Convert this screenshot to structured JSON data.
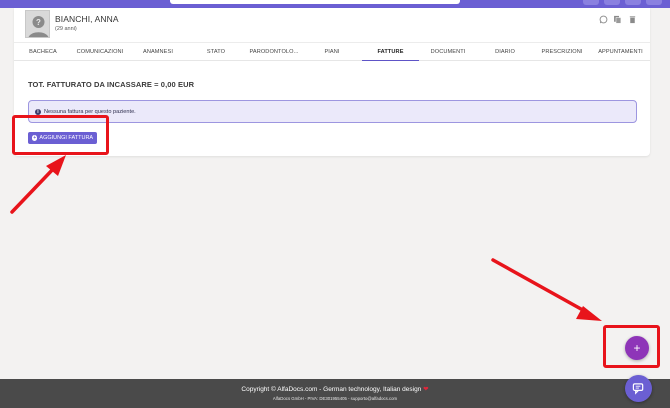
{
  "patient": {
    "name": "BIANCHI, ANNA",
    "age": "(29 anni)"
  },
  "header_icons": [
    "whatsapp-icon",
    "copy-icon",
    "trash-icon"
  ],
  "tabs": [
    {
      "label": "BACHECA",
      "active": false
    },
    {
      "label": "COMUNICAZIONI",
      "active": false
    },
    {
      "label": "ANAMNESI",
      "active": false
    },
    {
      "label": "STATO",
      "active": false
    },
    {
      "label": "PARODONTOLO...",
      "active": false
    },
    {
      "label": "PIANI",
      "active": false
    },
    {
      "label": "FATTURE",
      "active": true
    },
    {
      "label": "DOCUMENTI",
      "active": false
    },
    {
      "label": "DIARIO",
      "active": false
    },
    {
      "label": "PRESCRIZIONI",
      "active": false
    },
    {
      "label": "APPUNTAMENTI",
      "active": false
    }
  ],
  "invoices": {
    "total_label": "TOT. FATTURATO DA INCASSARE = 0,00 EUR",
    "empty_message": "Nessuna fattura per questo paziente.",
    "add_button_label": "AGGIUNGI FATTURA"
  },
  "fab": {
    "label": "+"
  },
  "footer": {
    "line1": "Copyright © AlfaDocs.com - German technology, Italian design",
    "heart": "❤",
    "line2": "AlfaDocs GmbH - PIVA: DE301955405 - supporto@alfadocs.com"
  },
  "colors": {
    "accent": "#6b5fd3",
    "fab": "#8e35b8",
    "annotation": "#e8141b",
    "footer_bg": "#4a4a4a"
  }
}
